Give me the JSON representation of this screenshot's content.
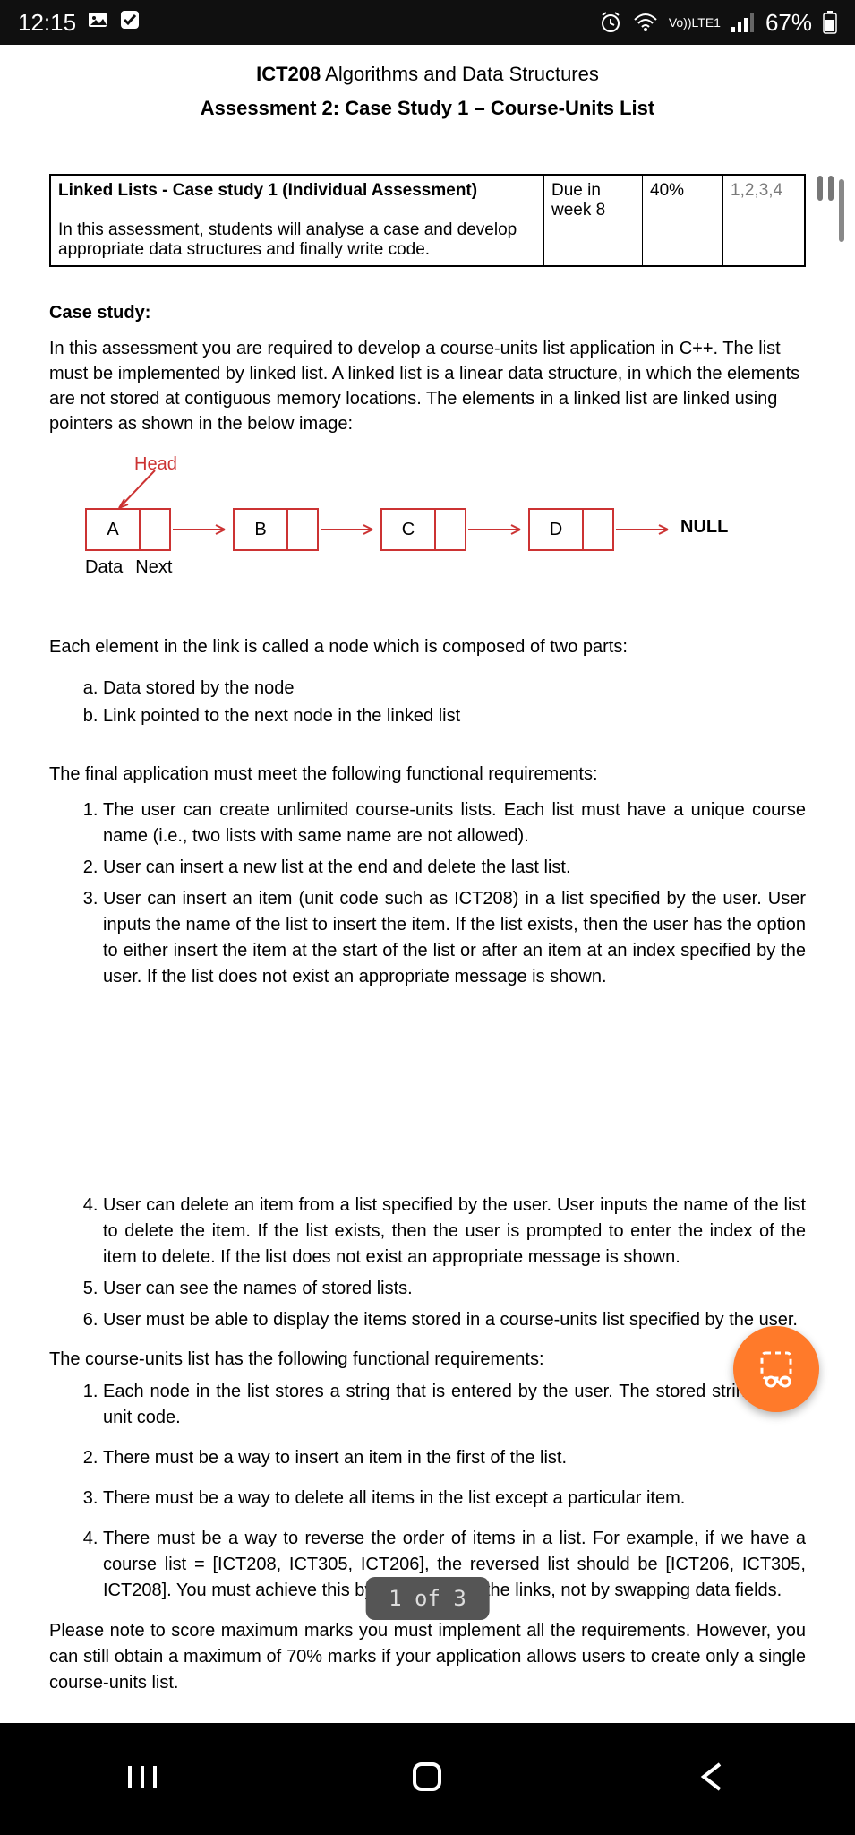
{
  "status": {
    "time": "12:15",
    "net": "LTE1",
    "vo": "Vo))",
    "battery": "67%"
  },
  "header": {
    "code": "ICT208",
    "title_rest": "Algorithms and Data Structures",
    "line2": "Assessment 2: Case Study 1 – Course-Units List"
  },
  "assess": {
    "title_b": "Linked Lists - Case study 1 (Individual Assessment)",
    "desc": "In this assessment, students will analyse a case and develop appropriate data structures and finally write code.",
    "due": "Due in week 8",
    "weight": "40%",
    "clo": "1,2,3,4"
  },
  "case": {
    "h": "Case study:",
    "p": "In this assessment you are required to develop a course-units list application in C++. The list must be implemented by linked list. A linked list is a linear data structure, in which the elements are not stored at contiguous memory locations. The elements in a linked list are linked using pointers as shown in the below image:"
  },
  "ll": {
    "head": "Head",
    "nodes": [
      "A",
      "B",
      "C",
      "D"
    ],
    "null": "NULL",
    "lbl_data": "Data",
    "lbl_next": "Next"
  },
  "nodeSub": {
    "intro": "Each element in the link is called a node which is composed of two parts:",
    "a": "Data stored by the node",
    "b": "Link pointed to the next node in the linked list"
  },
  "reqs": {
    "intro": "The final application must meet the following functional requirements:",
    "r1": "The user can create unlimited course-units lists. Each list must have a unique course name (i.e., two lists with same name are not allowed).",
    "r2": "User can insert a new list at the end and delete the last list.",
    "r3": "User can insert an item (unit code such as ICT208) in a list specified by the user. User inputs the name of the list to insert the item. If the list exists, then the user has the option to either insert the item at the start of the list or after an item at an index specified by the user. If the list does not exist an appropriate message is shown.",
    "r4": "User can delete an item from a list specified by the user. User inputs the name of the list to delete the item. If the list exists, then the user is prompted to enter the index of the item to delete. If the list does not exist an appropriate message is shown.",
    "r5": "User can see the names of stored lists.",
    "r6": "User must be able to display the items stored in a course-units list specified by the user."
  },
  "sub": {
    "intro": "The course-units list has the following functional requirements:",
    "s1": "Each node in the list stores a string that is entered by the user. The stored string is the unit code.",
    "s2": "There must be a way to insert an item in the first of the list.",
    "s3": "There must be a way to delete all items in the list except a particular item.",
    "s4": "There must be a way to reverse the order of items in a list. For example, if we have a course list = [ICT208, ICT305, ICT206], the reversed list should be [ICT206, ICT305, ICT208]. You must achieve this by manipulating the links, not by swapping data fields."
  },
  "final": "Please note to score maximum marks you must implement all the requirements. However, you can still obtain a maximum of 70% marks if your application allows users to create only a single course-units list.",
  "page_pill": "1 of 3"
}
